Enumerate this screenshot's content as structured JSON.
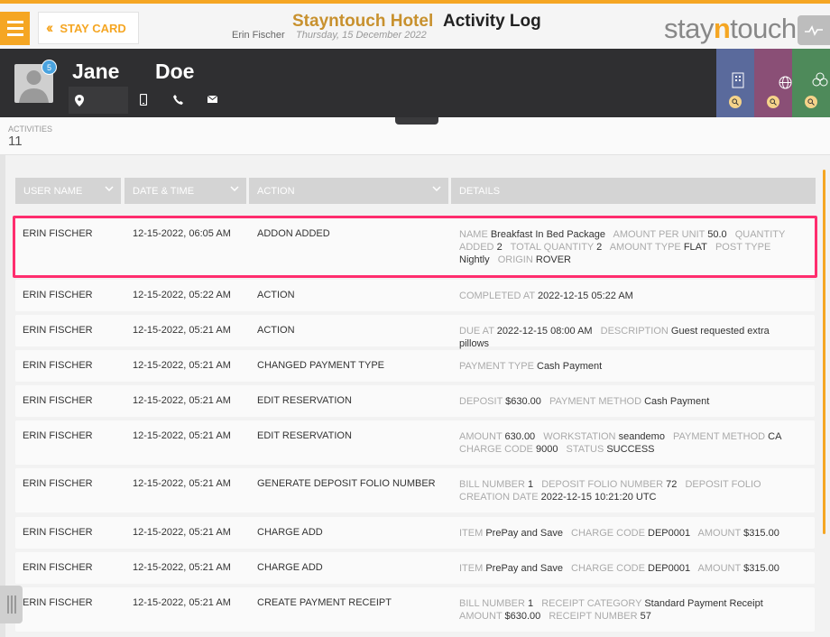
{
  "header": {
    "stay_card_label": "STAY CARD",
    "hotel_name": "Stayntouch Hotel",
    "page_title": "Activity Log",
    "user_name": "Erin Fischer",
    "date": "Thursday, 15 December 2022",
    "brand_a": "stay",
    "brand_n": "n",
    "brand_b": "touch"
  },
  "guest": {
    "first_name": "Jane",
    "last_name": "Doe",
    "badge_count": "5"
  },
  "stats": {
    "label": "ACTIVITIES",
    "value": "11"
  },
  "columns": [
    {
      "label": "USER NAME"
    },
    {
      "label": "DATE & TIME"
    },
    {
      "label": "ACTION"
    },
    {
      "label": "DETAILS"
    }
  ],
  "colors": {
    "accent": "#f5a623",
    "highlight": "#ff2d6e",
    "tile_blue": "#5a6a9c",
    "tile_purple": "#8a4f76",
    "tile_green": "#4e8a5a"
  },
  "rows": [
    {
      "user": "ERIN FISCHER",
      "datetime": "12-15-2022, 06:05 AM",
      "action": "ADDON ADDED",
      "details": [
        {
          "label": "NAME",
          "value": "Breakfast In Bed Package"
        },
        {
          "label": "AMOUNT PER UNIT",
          "value": "50.0"
        },
        {
          "label": "QUANTITY ADDED",
          "value": "2"
        },
        {
          "label": "TOTAL QUANTITY",
          "value": "2"
        },
        {
          "label": "AMOUNT TYPE",
          "value": "FLAT"
        },
        {
          "label": "POST TYPE",
          "value": "Nightly"
        },
        {
          "label": "ORIGIN",
          "value": "ROVER"
        }
      ]
    },
    {
      "user": "ERIN FISCHER",
      "datetime": "12-15-2022, 05:22 AM",
      "action": "ACTION",
      "details": [
        {
          "label": "COMPLETED AT",
          "value": "2022-12-15 05:22 AM"
        }
      ]
    },
    {
      "user": "ERIN FISCHER",
      "datetime": "12-15-2022, 05:21 AM",
      "action": "ACTION",
      "details": [
        {
          "label": "DUE AT",
          "value": "2022-12-15 08:00 AM"
        },
        {
          "label": "DESCRIPTION",
          "value": "Guest requested extra pillows"
        }
      ]
    },
    {
      "user": "ERIN FISCHER",
      "datetime": "12-15-2022, 05:21 AM",
      "action": "CHANGED PAYMENT TYPE",
      "details": [
        {
          "label": "PAYMENT TYPE",
          "value": "Cash Payment"
        }
      ]
    },
    {
      "user": "ERIN FISCHER",
      "datetime": "12-15-2022, 05:21 AM",
      "action": "EDIT RESERVATION",
      "details": [
        {
          "label": "DEPOSIT",
          "value": "$630.00"
        },
        {
          "label": "PAYMENT METHOD",
          "value": "Cash Payment"
        }
      ]
    },
    {
      "user": "ERIN FISCHER",
      "datetime": "12-15-2022, 05:21 AM",
      "action": "EDIT RESERVATION",
      "details": [
        {
          "label": "AMOUNT",
          "value": "630.00"
        },
        {
          "label": "WORKSTATION",
          "value": "seandemo"
        },
        {
          "label": "PAYMENT METHOD",
          "value": "CA"
        },
        {
          "label": "CHARGE CODE",
          "value": "9000"
        },
        {
          "label": "STATUS",
          "value": "SUCCESS"
        }
      ]
    },
    {
      "user": "ERIN FISCHER",
      "datetime": "12-15-2022, 05:21 AM",
      "action": "GENERATE DEPOSIT FOLIO NUMBER",
      "details": [
        {
          "label": "BILL NUMBER",
          "value": "1"
        },
        {
          "label": "DEPOSIT FOLIO NUMBER",
          "value": "72"
        },
        {
          "label": "DEPOSIT FOLIO CREATION DATE",
          "value": "2022-12-15 10:21:20 UTC"
        }
      ]
    },
    {
      "user": "ERIN FISCHER",
      "datetime": "12-15-2022, 05:21 AM",
      "action": "CHARGE ADD",
      "details": [
        {
          "label": "ITEM",
          "value": "PrePay and Save"
        },
        {
          "label": "CHARGE CODE",
          "value": "DEP0001"
        },
        {
          "label": "AMOUNT",
          "value": "$315.00"
        }
      ]
    },
    {
      "user": "ERIN FISCHER",
      "datetime": "12-15-2022, 05:21 AM",
      "action": "CHARGE ADD",
      "details": [
        {
          "label": "ITEM",
          "value": "PrePay and Save"
        },
        {
          "label": "CHARGE CODE",
          "value": "DEP0001"
        },
        {
          "label": "AMOUNT",
          "value": "$315.00"
        }
      ]
    },
    {
      "user": "ERIN FISCHER",
      "datetime": "12-15-2022, 05:21 AM",
      "action": "CREATE PAYMENT RECEIPT",
      "details": [
        {
          "label": "BILL NUMBER",
          "value": "1"
        },
        {
          "label": "RECEIPT CATEGORY",
          "value": "Standard Payment Receipt"
        },
        {
          "label": "AMOUNT",
          "value": "$630.00"
        },
        {
          "label": "RECEIPT NUMBER",
          "value": "57"
        }
      ]
    }
  ]
}
